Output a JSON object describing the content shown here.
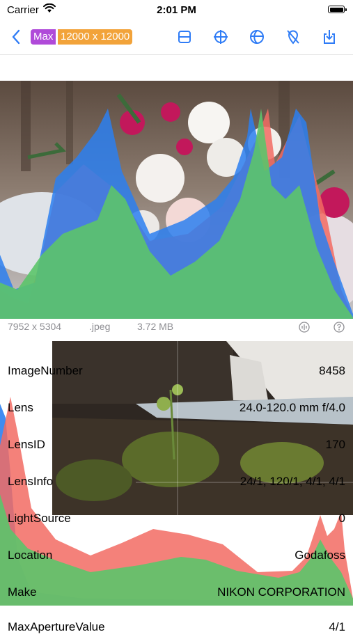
{
  "status_bar": {
    "carrier": "Carrier",
    "time": "2:01 PM"
  },
  "nav": {
    "max_label": "Max",
    "resolution": "12000 x 12000",
    "colors": {
      "accent": "#2f7cf6",
      "max_badge": "#b04ad9",
      "res_badge": "#f2a33a"
    },
    "toolbar_icons": [
      "layout-icon",
      "crosshair-icon",
      "globe-icon",
      "location-off-icon",
      "download-icon"
    ]
  },
  "image_info": {
    "dimensions": "7952 x 5304",
    "format": ".jpeg",
    "size": "3.72 MB"
  },
  "histogram_colors": {
    "red": "#f26b63",
    "green": "#5cc46a",
    "blue": "#2b7ff0"
  },
  "metadata": [
    {
      "key": "ImageNumber",
      "value": "8458"
    },
    {
      "key": "Lens",
      "value": "24.0-120.0 mm f/4.0"
    },
    {
      "key": "LensID",
      "value": "170"
    },
    {
      "key": "LensInfo",
      "value": "24/1, 120/1, 4/1, 4/1"
    },
    {
      "key": "LightSource",
      "value": "0"
    },
    {
      "key": "Location",
      "value": "Godafoss"
    },
    {
      "key": "Make",
      "value": "NIKON CORPORATION"
    },
    {
      "key": "MaxApertureValue",
      "value": "4/1"
    }
  ]
}
